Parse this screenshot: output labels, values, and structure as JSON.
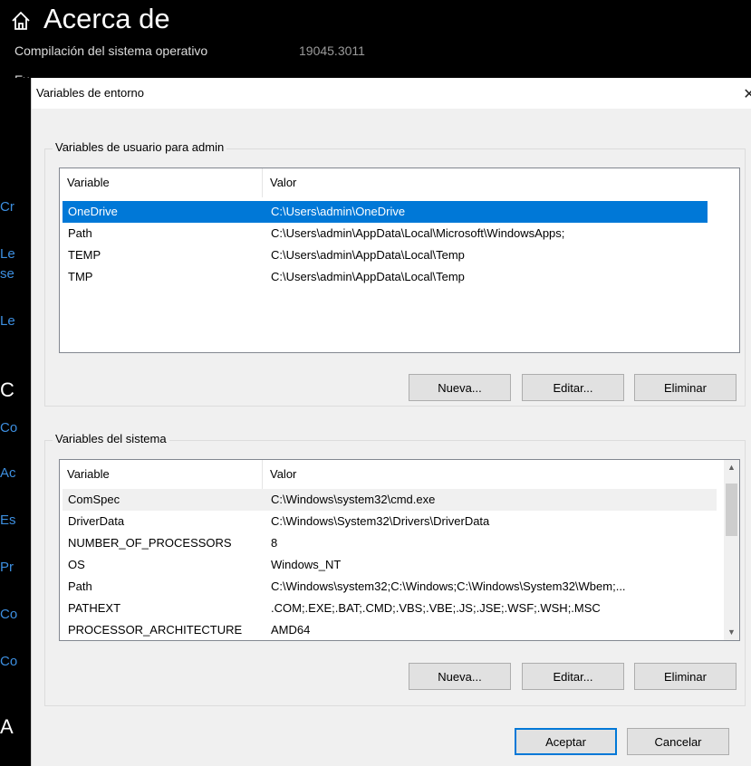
{
  "background": {
    "title": "Acerca de",
    "build_label": "Compilación del sistema operativo",
    "build_value": "19045.3011",
    "partial_text": "Ex",
    "left_fragments": [
      "Cr",
      "Le",
      "se",
      "Le",
      "C",
      "Co",
      "Ac",
      "Es",
      "Pr",
      "Co",
      "Co",
      "A"
    ]
  },
  "dialog": {
    "title": "Variables de entorno",
    "close_glyph": "✕",
    "user_group_label": "Variables de usuario para admin",
    "system_group_label": "Variables del sistema",
    "col_variable": "Variable",
    "col_value": "Valor",
    "user_vars": [
      {
        "name": "OneDrive",
        "value": "C:\\Users\\admin\\OneDrive"
      },
      {
        "name": "Path",
        "value": "C:\\Users\\admin\\AppData\\Local\\Microsoft\\WindowsApps;"
      },
      {
        "name": "TEMP",
        "value": "C:\\Users\\admin\\AppData\\Local\\Temp"
      },
      {
        "name": "TMP",
        "value": "C:\\Users\\admin\\AppData\\Local\\Temp"
      }
    ],
    "system_vars": [
      {
        "name": "ComSpec",
        "value": "C:\\Windows\\system32\\cmd.exe"
      },
      {
        "name": "DriverData",
        "value": "C:\\Windows\\System32\\Drivers\\DriverData"
      },
      {
        "name": "NUMBER_OF_PROCESSORS",
        "value": "8"
      },
      {
        "name": "OS",
        "value": "Windows_NT"
      },
      {
        "name": "Path",
        "value": "C:\\Windows\\system32;C:\\Windows;C:\\Windows\\System32\\Wbem;..."
      },
      {
        "name": "PATHEXT",
        "value": ".COM;.EXE;.BAT;.CMD;.VBS;.VBE;.JS;.JSE;.WSF;.WSH;.MSC"
      },
      {
        "name": "PROCESSOR_ARCHITECTURE",
        "value": "AMD64"
      }
    ],
    "user_buttons": {
      "new": "Nueva...",
      "edit": "Editar...",
      "delete": "Eliminar"
    },
    "system_buttons": {
      "new": "Nueva...",
      "edit": "Editar...",
      "delete": "Eliminar"
    },
    "ok": "Aceptar",
    "cancel": "Cancelar",
    "scroll_up_glyph": "▲",
    "scroll_down_glyph": "▼"
  },
  "colors": {
    "selection": "#0078d7",
    "link_blue": "#3d8fe0",
    "dialog_bg": "#f0f0f0"
  }
}
